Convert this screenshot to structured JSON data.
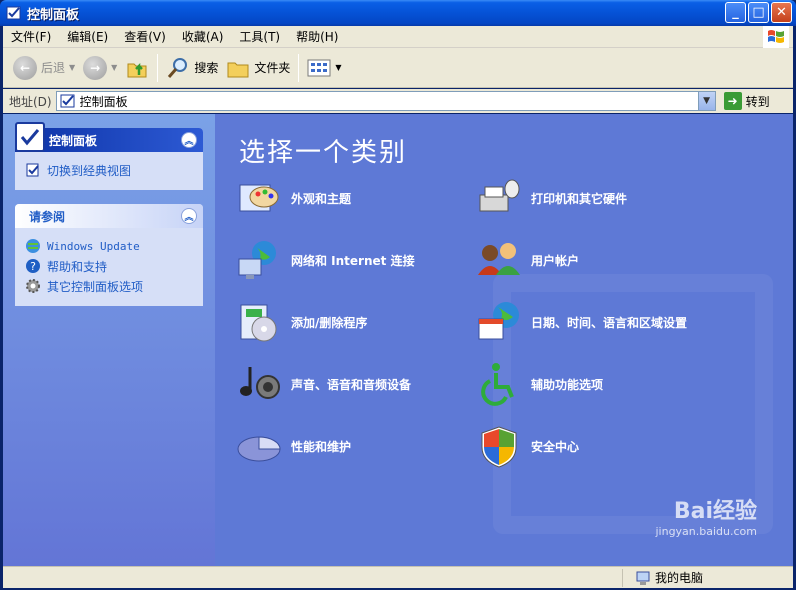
{
  "window": {
    "title": "控制面板"
  },
  "menu": [
    "文件(F)",
    "编辑(E)",
    "查看(V)",
    "收藏(A)",
    "工具(T)",
    "帮助(H)"
  ],
  "toolbar": {
    "back": "后退",
    "search": "搜索",
    "folders": "文件夹"
  },
  "address": {
    "label": "地址(D)",
    "value": "控制面板",
    "go": "转到"
  },
  "left": {
    "cp_panel_title": "控制面板",
    "switch_view": "切换到经典视图",
    "see_also_title": "请参阅",
    "see_also": [
      "Windows Update",
      "帮助和支持",
      "其它控制面板选项"
    ]
  },
  "main": {
    "title": "选择一个类别",
    "categories": [
      "外观和主题",
      "打印机和其它硬件",
      "网络和 Internet 连接",
      "用户帐户",
      "添加/删除程序",
      "日期、时间、语言和区域设置",
      "声音、语音和音频设备",
      "辅助功能选项",
      "性能和维护",
      "安全中心"
    ]
  },
  "status": {
    "computer": "我的电脑"
  },
  "watermark": {
    "brand": "Bai经验",
    "url": "jingyan.baidu.com"
  },
  "colors": {
    "titlebar": "#0552d6",
    "main_bg": "#5e79d6",
    "task_link": "#215dc6"
  }
}
